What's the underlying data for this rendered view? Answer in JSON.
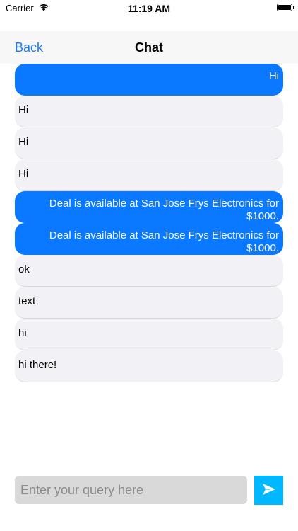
{
  "status_bar": {
    "carrier": "Carrier",
    "time": "11:19 AM"
  },
  "nav": {
    "back_label": "Back",
    "title": "Chat"
  },
  "messages": [
    {
      "direction": "outgoing",
      "text": "Hi"
    },
    {
      "direction": "incoming",
      "text": "Hi"
    },
    {
      "direction": "incoming",
      "text": "Hi"
    },
    {
      "direction": "incoming",
      "text": "Hi"
    },
    {
      "direction": "outgoing",
      "text": "Deal is available at San Jose Frys Electronics for $1000."
    },
    {
      "direction": "outgoing",
      "text": "Deal is available at San Jose Frys Electronics for $1000."
    },
    {
      "direction": "incoming",
      "text": "ok"
    },
    {
      "direction": "incoming",
      "text": "text"
    },
    {
      "direction": "incoming",
      "text": "hi"
    },
    {
      "direction": "incoming",
      "text": "hi there!"
    }
  ],
  "composer": {
    "placeholder": "Enter your query here",
    "value": ""
  },
  "colors": {
    "outgoing_bubble": "#0a78ff",
    "incoming_bubble": "#f1f1f6",
    "accent": "#1a7cf0",
    "send_button": "#00b8ff"
  },
  "icons": {
    "status": [
      "wifi-icon",
      "battery-icon"
    ],
    "send": "send-icon"
  }
}
